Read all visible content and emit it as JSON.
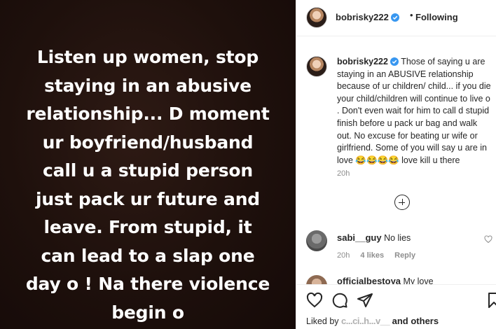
{
  "post": {
    "text_lines": [
      "Listen up women, stop",
      "staying in an abusive",
      "relationship... D moment",
      "ur boyfriend/husband",
      "call u a stupid person",
      "just pack ur future and",
      "leave. From stupid, it",
      "can lead to a slap one",
      "day o ! Na there violence",
      "begin o"
    ],
    "background_color": "#1e100c"
  },
  "header": {
    "username": "bobrisky222",
    "verified_icon": "verified-badge-icon",
    "separator": "•",
    "follow_status": "Following"
  },
  "caption": {
    "username": "bobrisky222",
    "text": "Those of saying u are staying in an ABUSIVE relationship because of ur children/ child... if you die your child/children will continue to live o . Don't even wait for him to call d stupid finish before u pack ur bag and walk out. No excuse for beating ur wife or girlfriend. Some of you will say u are in love 😂😂😂😂 love kill u there",
    "time": "20h"
  },
  "comments": [
    {
      "username": "sabi__guy",
      "text": "No lies",
      "time": "20h",
      "likes": "4 likes",
      "reply": "Reply"
    },
    {
      "username": "officialbestoya",
      "text": "My love"
    }
  ],
  "actions": {
    "liked_by_prefix": "Liked by",
    "liked_by_user": "c...ci..h...v__",
    "liked_by_suffix": "and others"
  },
  "colors": {
    "accent_blue": "#3897f0",
    "text": "#262626",
    "muted": "#8e8e8e"
  }
}
